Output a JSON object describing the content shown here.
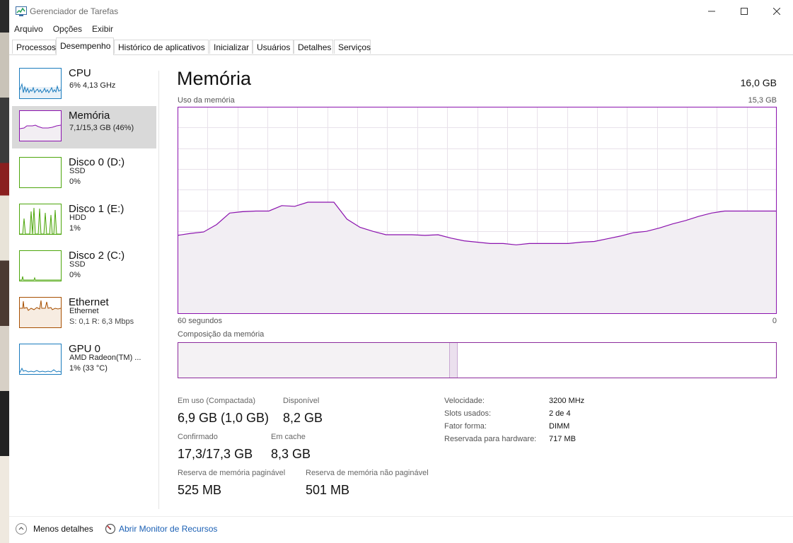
{
  "window": {
    "title": "Gerenciador de Tarefas"
  },
  "menu": [
    "Arquivo",
    "Opções",
    "Exibir"
  ],
  "tabs": [
    "Processos",
    "Desempenho",
    "Histórico de aplicativos",
    "Inicializar",
    "Usuários",
    "Detalhes",
    "Serviços"
  ],
  "active_tab": "Desempenho",
  "sidebar": {
    "items": [
      {
        "title": "CPU",
        "sub1": "6% 4,13 GHz",
        "sub2": "",
        "color": "#1a7bbd"
      },
      {
        "title": "Memória",
        "sub1": "7,1/15,3 GB (46%)",
        "sub2": "",
        "color": "#8b12ae",
        "selected": true
      },
      {
        "title": "Disco 0 (D:)",
        "sub1": "SSD",
        "sub2": "0%",
        "color": "#4da60c"
      },
      {
        "title": "Disco 1 (E:)",
        "sub1": "HDD",
        "sub2": "1%",
        "color": "#4da60c"
      },
      {
        "title": "Disco 2 (C:)",
        "sub1": "SSD",
        "sub2": "0%",
        "color": "#4da60c"
      },
      {
        "title": "Ethernet",
        "sub1": "Ethernet",
        "sub2": "S: 0,1  R: 6,3 Mbps",
        "color": "#a74f01"
      },
      {
        "title": "GPU 0",
        "sub1": "AMD Radeon(TM) ...",
        "sub2": "1% (33 °C)",
        "color": "#1a7bbd"
      }
    ]
  },
  "main": {
    "title": "Memória",
    "total": "16,0 GB",
    "usage_label": "Uso da memória",
    "usage_max": "15,3 GB",
    "time_left": "60 segundos",
    "time_right": "0",
    "composition_label": "Composição da memória",
    "stats": {
      "in_use_label": "Em uso (Compactada)",
      "in_use_value": "6,9 GB (1,0 GB)",
      "available_label": "Disponível",
      "available_value": "8,2 GB",
      "committed_label": "Confirmado",
      "committed_value": "17,3/17,3 GB",
      "cached_label": "Em cache",
      "cached_value": "8,3 GB",
      "paged_label": "Reserva de memória paginável",
      "paged_value": "525 MB",
      "nonpaged_label": "Reserva de memória não paginável",
      "nonpaged_value": "501 MB"
    },
    "props": [
      {
        "label": "Velocidade:",
        "value": "3200 MHz"
      },
      {
        "label": "Slots usados:",
        "value": "2 de 4"
      },
      {
        "label": "Fator forma:",
        "value": "DIMM"
      },
      {
        "label": "Reservada para hardware:",
        "value": "717 MB"
      }
    ]
  },
  "memory_history_gb": [
    5.8,
    5.95,
    6.05,
    6.6,
    7.45,
    7.55,
    7.6,
    7.6,
    8.0,
    7.95,
    8.25,
    8.25,
    8.25,
    7.0,
    6.4,
    6.1,
    5.85,
    5.85,
    5.85,
    5.8,
    5.85,
    5.6,
    5.4,
    5.3,
    5.2,
    5.2,
    5.1,
    5.2,
    5.2,
    5.2,
    5.2,
    5.3,
    5.35,
    5.55,
    5.75,
    6.0,
    6.1,
    6.35,
    6.65,
    6.9,
    7.2,
    7.45,
    7.6,
    7.6,
    7.6,
    7.6,
    7.6
  ],
  "composition": {
    "in_use_fraction": 0.455,
    "modified_fraction": 0.013
  },
  "colors": {
    "memory": "#8b12ae",
    "memory_fill": "#f2eef3",
    "grid": "#e8e1ea"
  },
  "footer": {
    "less_details": "Menos detalhes",
    "resource_monitor": "Abrir Monitor de Recursos"
  }
}
